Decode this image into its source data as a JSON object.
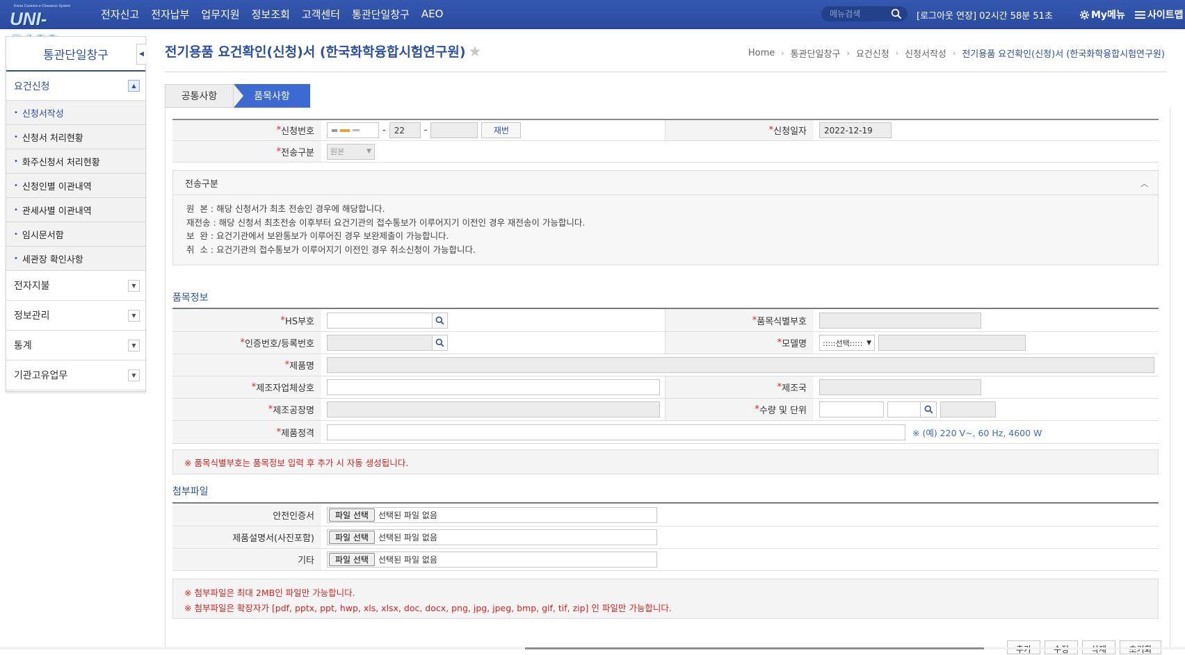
{
  "header": {
    "logo_small": "Korea Customs e-Clearance System",
    "logo_big": "UNI-PASS",
    "nav": [
      "전자신고",
      "전자납부",
      "업무지원",
      "정보조회",
      "고객센터",
      "통관단일창구",
      "AEO"
    ],
    "search_placeholder": "메뉴검색",
    "session": "[로그아웃 연장] 02시간 58분 51초",
    "mymenu": "My메뉴",
    "sitemap": "사이트맵"
  },
  "sidebar": {
    "title": "통관단일창구",
    "group": "요건신청",
    "subitems": [
      "신청서작성",
      "신청서 처리현황",
      "화주신청서 처리현황",
      "신청인별 이관내역",
      "관세사별 이관내역",
      "임시문서함",
      "세관장 확인사항"
    ],
    "menus": [
      "전자지불",
      "정보관리",
      "통계",
      "기관고유업무"
    ]
  },
  "page": {
    "title": "전기용품 요건확인(신청)서 (한국화학융합시험연구원)",
    "breadcrumb": [
      "Home",
      "통관단일창구",
      "요건신청",
      "신청서작성",
      "전기용품 요건확인(신청)서 (한국화학융합시험연구원)"
    ]
  },
  "tabs": [
    "공통사항",
    "품목사항"
  ],
  "common": {
    "req_no_label": "신청번호",
    "req_no_part2": "22",
    "reissue_button": "재번",
    "req_date_label": "신청일자",
    "req_date": "2022-12-19",
    "send_type_label": "전송구분",
    "send_type_value": "원본"
  },
  "info": {
    "title": "전송구분",
    "lines": [
      "원  본 : 해당 신청서가 최초 전송인 경우에 해당합니다.",
      "재전송 : 해당 신청서 최초전송 이후부터 요건기관의 접수통보가 이루어지기 이전인 경우 재전송이 가능합니다.",
      "보  완 : 요건기관에서 보완통보가 이루어진 경우 보완제출이 가능합니다.",
      "취  소 : 요건기관의 접수통보가 이루어지기 이전인 경우 취소신청이 가능합니다."
    ]
  },
  "items": {
    "section_title": "품목정보",
    "hs_label": "HS부호",
    "item_id_label": "품목식별부호",
    "cert_label": "인증번호/등록번호",
    "model_label": "모델명",
    "model_select": ":::::선택:::::",
    "product_label": "제품명",
    "maker_label": "제조자업체상호",
    "country_label": "제조국",
    "factory_label": "제조공장명",
    "qty_label": "수량 및 단위",
    "spec_label": "제품정격",
    "spec_hint": "※ (예) 220 V~, 60 Hz, 4600 W",
    "note": "※ 품목식별부호는 품목정보 입력 후 추가 시 자동 생성됩니다."
  },
  "attach": {
    "section_title": "첨부파일",
    "rows": [
      {
        "label": "안전인증서"
      },
      {
        "label": "제품설명서(사진포함)"
      },
      {
        "label": "기타"
      }
    ],
    "file_button": "파일 선택",
    "file_none": "선택된 파일 없음",
    "notes": [
      "※ 첨부파일은 최대 2MB인 파일만 가능합니다.",
      "※ 첨부파일은 확장자가 [pdf, pptx, ppt, hwp, xls, xlsx, doc, docx, png, jpg, jpeg, bmp, gif, tif, zip] 인 파일만 가능합니다."
    ]
  },
  "bottom_buttons": [
    "추가",
    "수정",
    "삭제",
    "초기화"
  ],
  "colors": {
    "brand": "#2d4fa3",
    "tab_active": "#3c6ad0",
    "required": "#d22222",
    "warning": "#e02020"
  }
}
